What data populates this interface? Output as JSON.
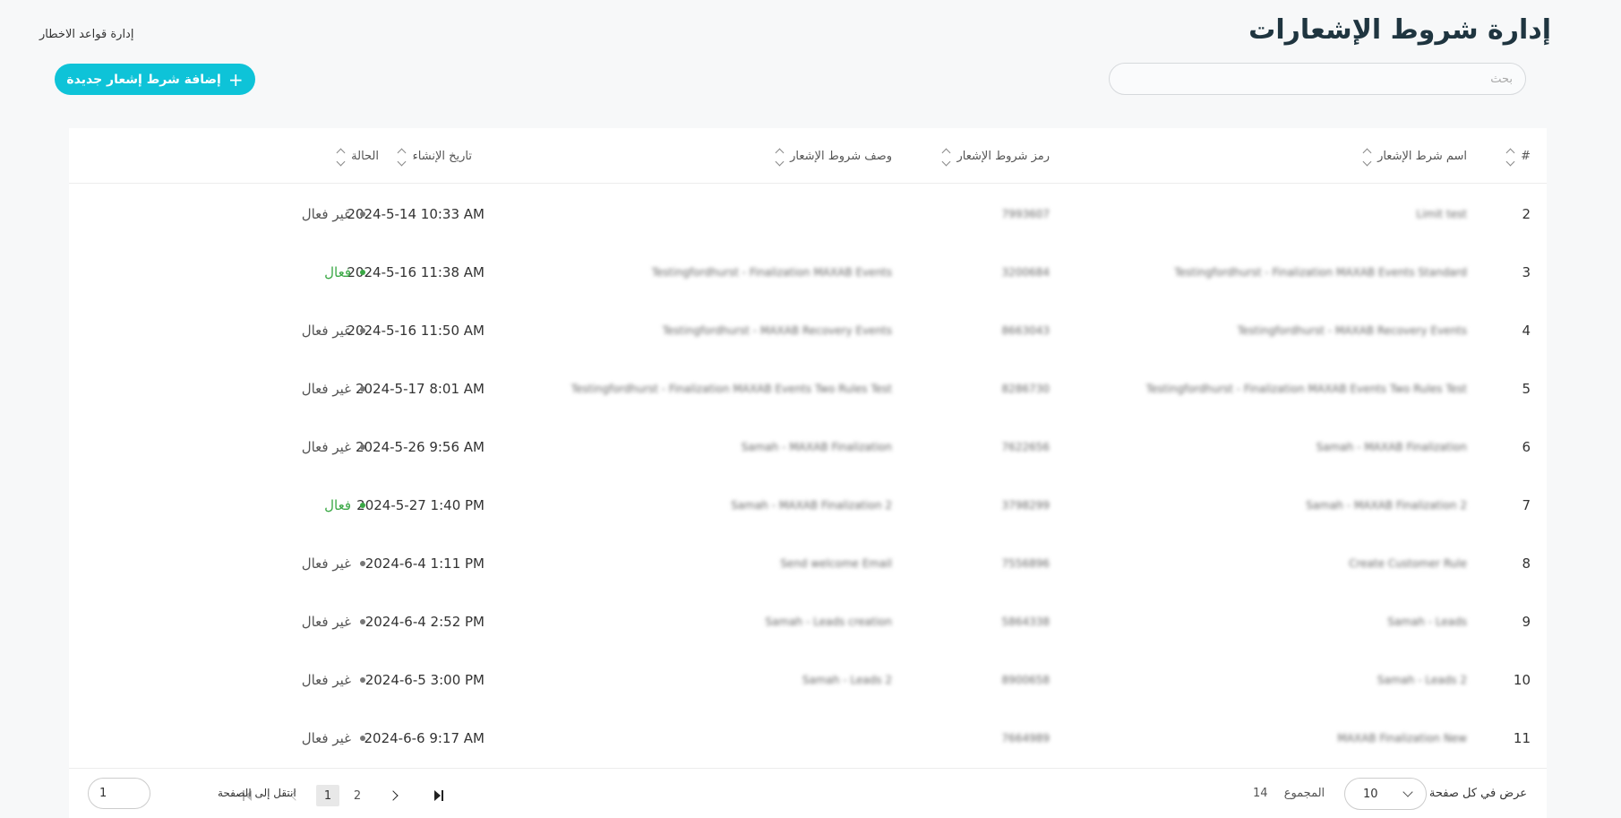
{
  "header": {
    "title": "إدارة شروط الإشعارات",
    "breadcrumb_link": "إدارة قواعد الاخطار",
    "search_placeholder": "بحث",
    "add_button_label": "إضافة شرط إشعار جديدة"
  },
  "table": {
    "columns": {
      "index": "#",
      "name": "اسم شرط الإشعار",
      "code": "رمز شروط الإشعار",
      "description": "وصف شروط الإشعار",
      "created": "تاريخ الإنشاء",
      "status": "الحالة"
    },
    "rows": [
      {
        "index": "2",
        "name": "Limit test",
        "code": "7993607",
        "description": "",
        "created": "2024-5-14 10:33 AM",
        "status": "غير فعال",
        "active": false
      },
      {
        "index": "3",
        "name": "Testingfordhurst - Finalization MAXAB Events Standard",
        "code": "3200684",
        "description": "Testingfordhurst - Finalization MAXAB Events",
        "created": "2024-5-16 11:38 AM",
        "status": "فعال",
        "active": true
      },
      {
        "index": "4",
        "name": "Testingfordhurst - MAXAB Recovery Events",
        "code": "8663043",
        "description": "Testingfordhurst - MAXAB Recovery Events",
        "created": "2024-5-16 11:50 AM",
        "status": "غير فعال",
        "active": false
      },
      {
        "index": "5",
        "name": "Testingfordhurst - Finalization MAXAB Events Two Rules Test",
        "code": "8286730",
        "description": "Testingfordhurst - Finalization MAXAB Events Two Rules Test",
        "created": "2024-5-17 8:01 AM",
        "status": "غير فعال",
        "active": false
      },
      {
        "index": "6",
        "name": "Samah - MAXAB Finalization",
        "code": "7622656",
        "description": "Samah - MAXAB Finalization",
        "created": "2024-5-26 9:56 AM",
        "status": "غير فعال",
        "active": false
      },
      {
        "index": "7",
        "name": "Samah - MAXAB Finalization 2",
        "code": "3798299",
        "description": "Samah - MAXAB Finalization 2",
        "created": "2024-5-27 1:40 PM",
        "status": "فعال",
        "active": true
      },
      {
        "index": "8",
        "name": "Create Customer Rule",
        "code": "7556896",
        "description": "Send welcome Email",
        "created": "2024-6-4 1:11 PM",
        "status": "غير فعال",
        "active": false
      },
      {
        "index": "9",
        "name": "Samah - Leads",
        "code": "5864338",
        "description": "Samah - Leads creation",
        "created": "2024-6-4 2:52 PM",
        "status": "غير فعال",
        "active": false
      },
      {
        "index": "10",
        "name": "Samah - Leads 2",
        "code": "8900658",
        "description": "Samah - Leads 2",
        "created": "2024-6-5 3:00 PM",
        "status": "غير فعال",
        "active": false
      },
      {
        "index": "11",
        "name": "MAXAB Finalization New",
        "code": "7664989",
        "description": "",
        "created": "2024-6-6 9:17 AM",
        "status": "غير فعال",
        "active": false
      }
    ]
  },
  "footer": {
    "page_size_label": "عرض في كل صفحة",
    "page_size_value": "10",
    "total_label": "المجموع",
    "total_value": "14",
    "pages": [
      "1",
      "2"
    ],
    "current_page": "1",
    "goto_label": "انتقل إلى الصفحة",
    "goto_value": "1"
  },
  "colors": {
    "accent": "#0ec3d8",
    "active_status": "#3aa845",
    "inactive_status": "#555555",
    "title": "#1f3540"
  },
  "icons": {
    "add": "plus-icon",
    "sort": "sort-icon",
    "page_size": "chevron-down-icon",
    "first": "first-page-icon",
    "prev": "chevron-left-icon",
    "next": "chevron-right-icon",
    "last": "last-page-icon"
  }
}
